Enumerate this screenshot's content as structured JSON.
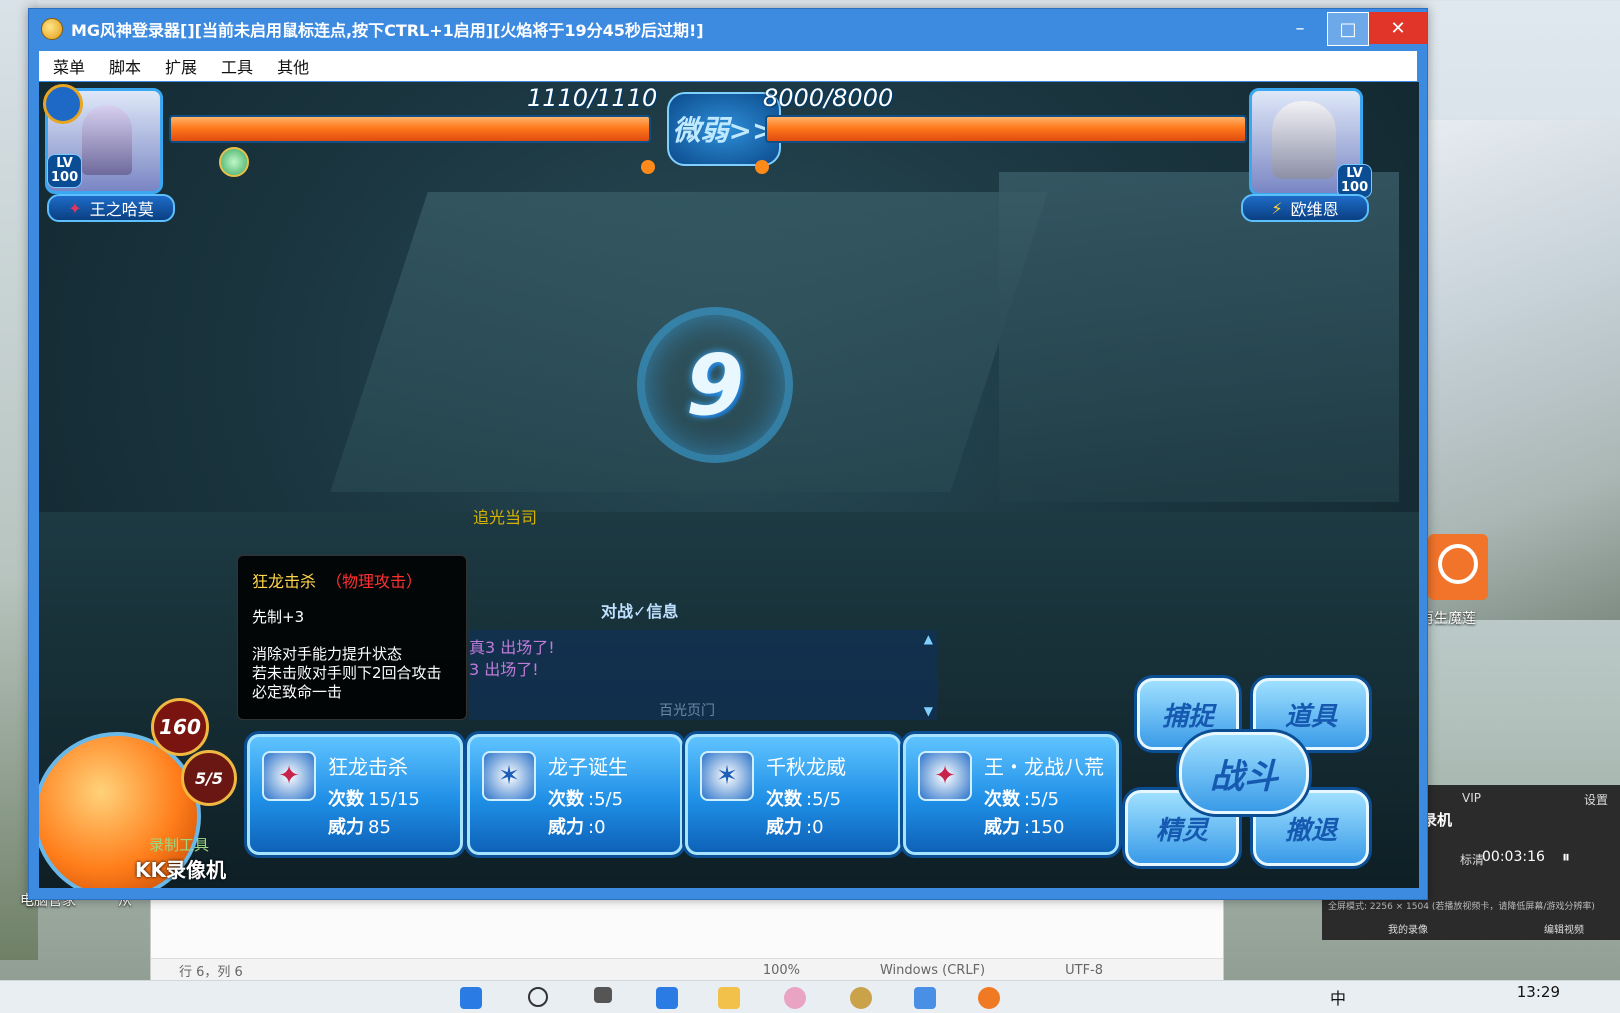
{
  "window": {
    "title": "MG风神登录器[][当前未启用鼠标连点,按下CTRL+1启用][火焰将于19分45秒后过期!]",
    "minimize_glyph": "–",
    "maximize_glyph": "□",
    "close_glyph": "✕"
  },
  "menu": {
    "items": [
      "菜单",
      "脚本",
      "扩展",
      "工具",
      "其他"
    ]
  },
  "battle": {
    "player": {
      "hp_text": "1110/1110",
      "name": "王之哈莫",
      "lv_label": "LV",
      "lv_value": "100"
    },
    "enemy": {
      "hp_text": "8000/8000",
      "name": "欧维恩",
      "lv_label": "LV",
      "lv_value": "100"
    },
    "matchup_label": "微弱>>",
    "countdown": "9",
    "floor_text": "追光当司",
    "mode_label": "对战✓信息",
    "log_lines": [
      "真3 出场了!",
      "3 出场了!",
      "百光页门"
    ],
    "energy": "160",
    "pet_count": "5/5"
  },
  "tooltip": {
    "skill_name": "狂龙击杀",
    "skill_type": "（物理攻击）",
    "priority": "先制+3",
    "description": "消除对手能力提升状态\n若未击败对手则下2回合攻击必定致命一击"
  },
  "skills": [
    {
      "name": "狂龙击杀",
      "count_label": "次数",
      "count": "15/15",
      "power_label": "威力",
      "power": "85"
    },
    {
      "name": "龙子诞生",
      "count_label": "次数",
      "count": ":5/5",
      "power_label": "威力",
      "power": ":0"
    },
    {
      "name": "千秋龙威",
      "count_label": "次数",
      "count": ":5/5",
      "power_label": "威力",
      "power": ":0"
    },
    {
      "name": "王・龙战八荒",
      "count_label": "次数",
      "count": ":5/5",
      "power_label": "威力",
      "power": ":150"
    }
  ],
  "commands": {
    "capture": "捕捉",
    "items": "道具",
    "fight": "战斗",
    "spirit": "精灵",
    "escape": "撤退"
  },
  "watermark": {
    "line1": "录制工具",
    "line2": "KK录像机"
  },
  "desktop": {
    "icon1": "电脑管家",
    "icon2": "从",
    "side_app": "再生魔莲"
  },
  "recorder": {
    "vip": "VIP",
    "settings": "设置",
    "title": "录机",
    "quality": "标清",
    "time": "00:03:16",
    "footer_left": "我的录像",
    "footer_right": "编辑视频",
    "info": "全屏模式: 2256 × 1504 (若播放视频卡，请降低屏幕/游戏分辨率)"
  },
  "notepad_status": {
    "line": "行 6，列 6",
    "zoom": "100%",
    "eol": "Windows (CRLF)",
    "enc": "UTF-8"
  },
  "taskbar": {
    "time": "13:29",
    "ime": "中"
  },
  "colors": {
    "window_blue": "#3d8be0",
    "hp_orange": "#ff7a1c",
    "close_red": "#e2352a"
  }
}
